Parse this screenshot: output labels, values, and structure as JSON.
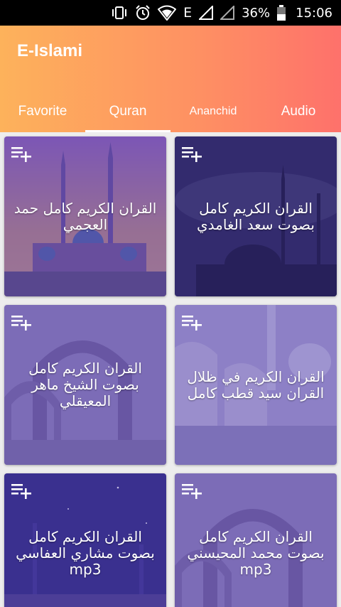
{
  "status_bar": {
    "network": "E",
    "battery_percent": "36%",
    "time": "15:06",
    "icons": [
      "vibrate-icon",
      "alarm-icon",
      "wifi-icon",
      "signal-icon",
      "battery-icon"
    ]
  },
  "app": {
    "title": "E-Islami"
  },
  "tabs": [
    {
      "label": "Favorite"
    },
    {
      "label": "Quran"
    },
    {
      "label": "Ananchid"
    },
    {
      "label": "Audio"
    }
  ],
  "active_tab": "Quran",
  "colors": {
    "appbar_start": "#fdb25b",
    "appbar_end": "#fe716b",
    "card_overlay": "#5846aa"
  },
  "cards": [
    {
      "title": "القران الكريم كامل حمد العجمي",
      "icon": "playlist-add-icon"
    },
    {
      "title": "القران الكريم كامل بصوت سعد الغامدي",
      "icon": "playlist-add-icon"
    },
    {
      "title": "القران الكريم كامل بصوت الشيخ ماهر المعيقلي",
      "icon": "playlist-add-icon"
    },
    {
      "title": "القران الكريم في ظلال القران سيد قطب كامل",
      "icon": "playlist-add-icon"
    },
    {
      "title": "القران الكريم كامل بصوت مشاري العفاسي mp3",
      "icon": "playlist-add-icon"
    },
    {
      "title": "القران الكريم كامل بصوت محمد المحيسني mp3",
      "icon": "playlist-add-icon"
    }
  ]
}
